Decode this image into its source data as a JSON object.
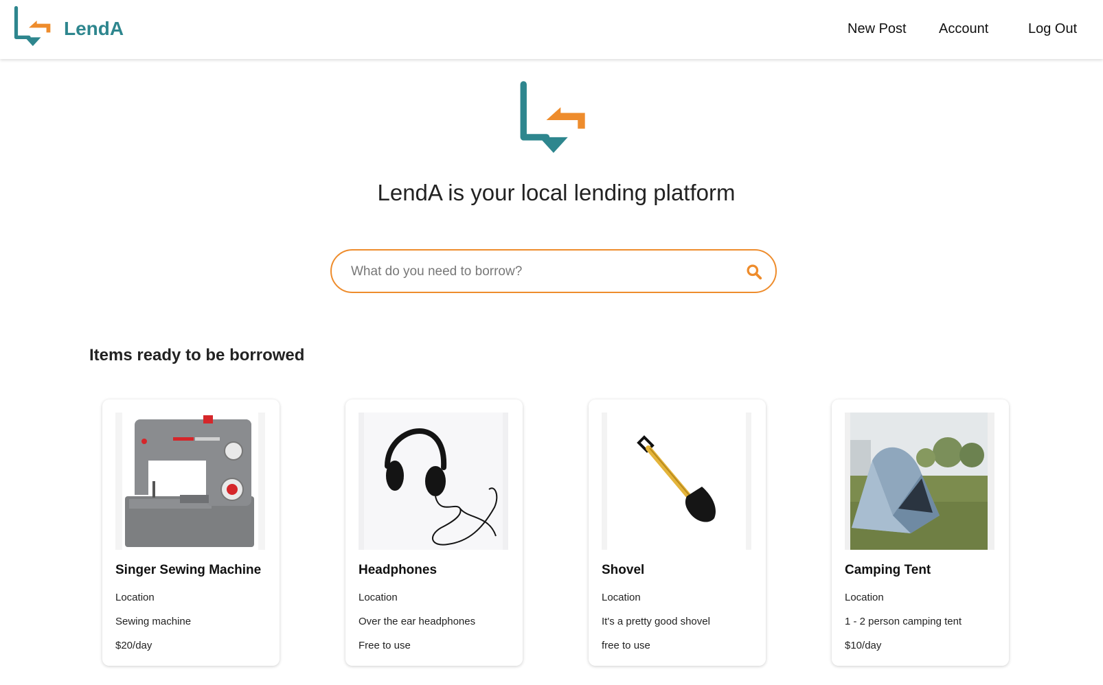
{
  "header": {
    "brand": "LendA",
    "logo_icon": "lenda-logo-icon",
    "nav": [
      {
        "label": "New Post"
      },
      {
        "label": "Account"
      },
      {
        "label": "Log Out"
      }
    ]
  },
  "hero": {
    "logo_icon": "lenda-logo-icon",
    "tagline": "LendA is your local lending platform"
  },
  "search": {
    "placeholder": "What do you need to borrow?",
    "value": "",
    "icon": "search-icon"
  },
  "items_section": {
    "title": "Items ready to be borrowed",
    "items": [
      {
        "title": "Singer Sewing Machine",
        "location": "Location",
        "description": "Sewing machine",
        "price": "$20/day",
        "image_icon": "sewing-machine-image"
      },
      {
        "title": "Headphones",
        "location": "Location",
        "description": "Over the ear headphones",
        "price": "Free to use",
        "image_icon": "headphones-image"
      },
      {
        "title": "Shovel",
        "location": "Location",
        "description": "It's a pretty good shovel",
        "price": "free to use",
        "image_icon": "shovel-image"
      },
      {
        "title": "Camping Tent",
        "location": "Location",
        "description": "1 - 2 person camping tent",
        "price": "$10/day",
        "image_icon": "tent-image"
      }
    ]
  },
  "colors": {
    "brand_teal": "#2e868e",
    "accent_orange": "#ee8c2c",
    "text": "#222222",
    "background": "#ffffff"
  }
}
